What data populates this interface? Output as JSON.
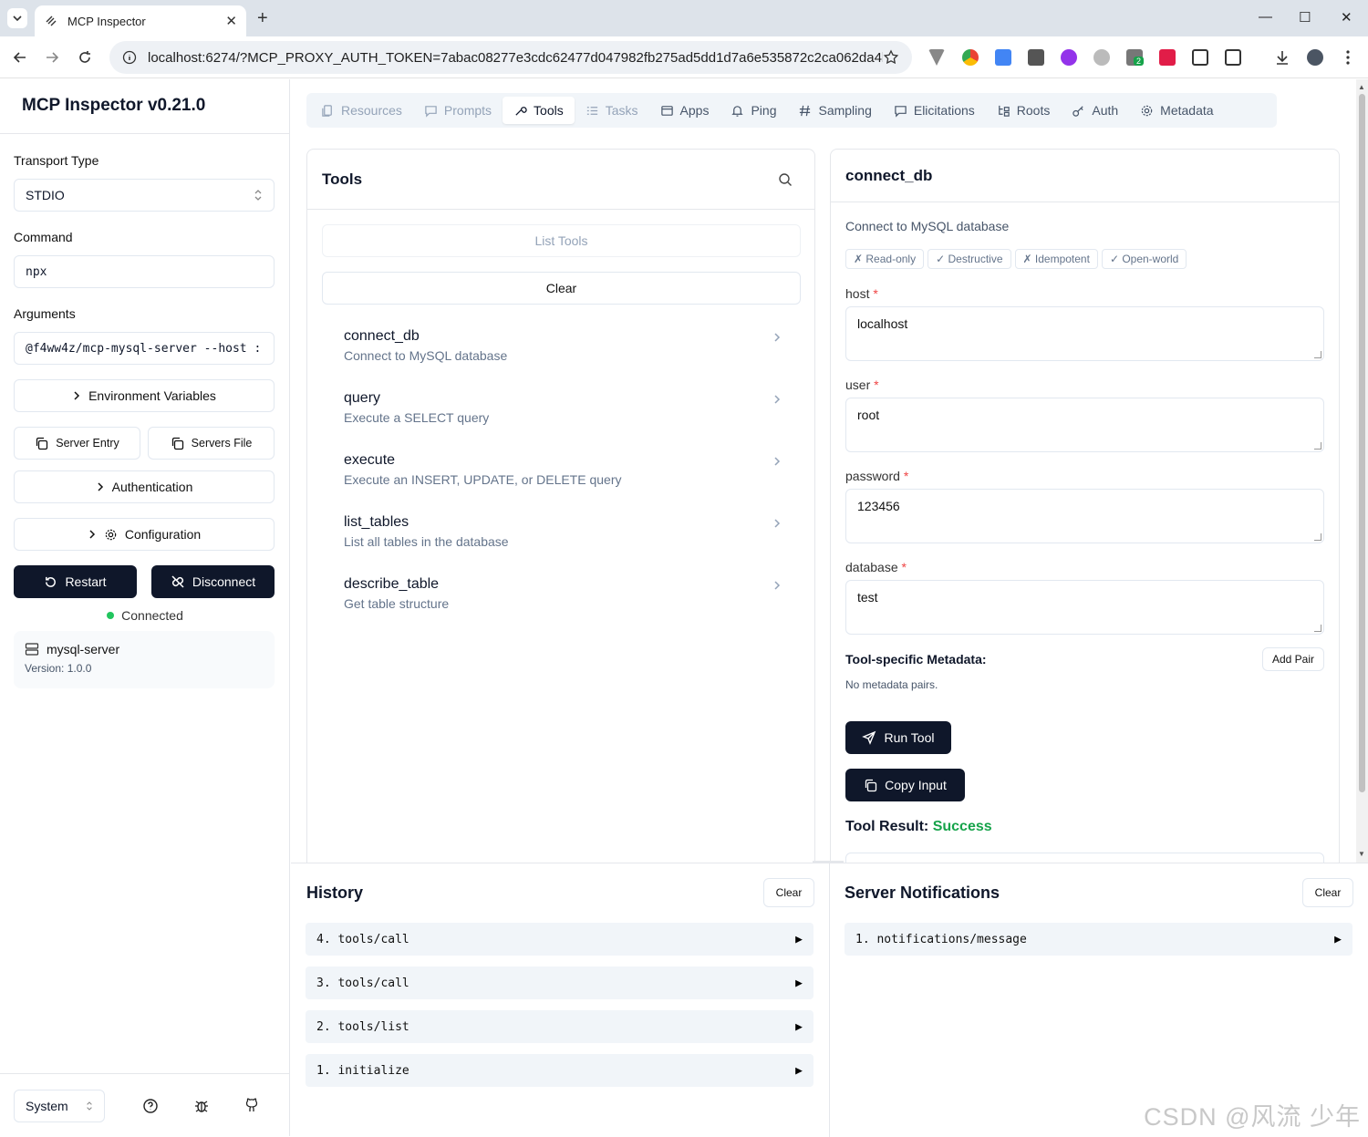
{
  "browser": {
    "tab_title": "MCP Inspector",
    "tab_close": "✕",
    "new_tab": "+",
    "url": "localhost:6274/?MCP_PROXY_AUTH_TOKEN=7abac08277e3cdc62477d047982fb275ad5dd1d7a6e535872c2ca062da4b...",
    "ext_badge": "2"
  },
  "sidebar": {
    "title": "MCP Inspector v0.21.0",
    "transport_label": "Transport Type",
    "transport_value": "STDIO",
    "command_label": "Command",
    "command_value": "npx",
    "arguments_label": "Arguments",
    "arguments_value": "@f4ww4z/mcp-mysql-server --host :",
    "env_button": "Environment Variables",
    "server_entry_button": "Server Entry",
    "servers_file_button": "Servers File",
    "auth_button": "Authentication",
    "config_button": "Configuration",
    "restart_button": "Restart",
    "disconnect_button": "Disconnect",
    "status_text": "Connected",
    "server_name": "mysql-server",
    "server_version": "Version: 1.0.0",
    "theme_value": "System"
  },
  "tabs": [
    {
      "label": "Resources",
      "icon": "resources-icon",
      "state": "disabled"
    },
    {
      "label": "Prompts",
      "icon": "prompts-icon",
      "state": "disabled"
    },
    {
      "label": "Tools",
      "icon": "tools-icon",
      "state": "active"
    },
    {
      "label": "Tasks",
      "icon": "tasks-icon",
      "state": "disabled"
    },
    {
      "label": "Apps",
      "icon": "apps-icon",
      "state": "normal"
    },
    {
      "label": "Ping",
      "icon": "bell-icon",
      "state": "normal"
    },
    {
      "label": "Sampling",
      "icon": "hash-icon",
      "state": "normal"
    },
    {
      "label": "Elicitations",
      "icon": "message-icon",
      "state": "normal"
    },
    {
      "label": "Roots",
      "icon": "roots-icon",
      "state": "normal"
    },
    {
      "label": "Auth",
      "icon": "key-icon",
      "state": "normal"
    },
    {
      "label": "Metadata",
      "icon": "gear-icon",
      "state": "normal"
    }
  ],
  "tools_panel": {
    "title": "Tools",
    "list_button": "List Tools",
    "clear_button": "Clear",
    "items": [
      {
        "name": "connect_db",
        "desc": "Connect to MySQL database"
      },
      {
        "name": "query",
        "desc": "Execute a SELECT query"
      },
      {
        "name": "execute",
        "desc": "Execute an INSERT, UPDATE, or DELETE query"
      },
      {
        "name": "list_tables",
        "desc": "List all tables in the database"
      },
      {
        "name": "describe_table",
        "desc": "Get table structure"
      }
    ]
  },
  "detail": {
    "title": "connect_db",
    "description": "Connect to MySQL database",
    "badges": [
      "✗ Read-only",
      "✓ Destructive",
      "✗ Idempotent",
      "✓ Open-world"
    ],
    "params": [
      {
        "label": "host",
        "value": "localhost"
      },
      {
        "label": "user",
        "value": "root"
      },
      {
        "label": "password",
        "value": "123456"
      },
      {
        "label": "database",
        "value": "test"
      }
    ],
    "required_mark": "*",
    "metadata_label": "Tool-specific Metadata:",
    "add_pair_button": "Add Pair",
    "no_metadata": "No metadata pairs.",
    "run_button": "Run Tool",
    "copy_button": "Copy Input",
    "result_label": "Tool Result:",
    "result_status": "Success",
    "success_color": "#16a34a"
  },
  "history": {
    "title": "History",
    "clear_button": "Clear",
    "items": [
      "4. tools/call",
      "3. tools/call",
      "2. tools/list",
      "1. initialize"
    ]
  },
  "notifications": {
    "title": "Server Notifications",
    "clear_button": "Clear",
    "items": [
      "1. notifications/message"
    ]
  },
  "watermark": "CSDN @风流 少年"
}
